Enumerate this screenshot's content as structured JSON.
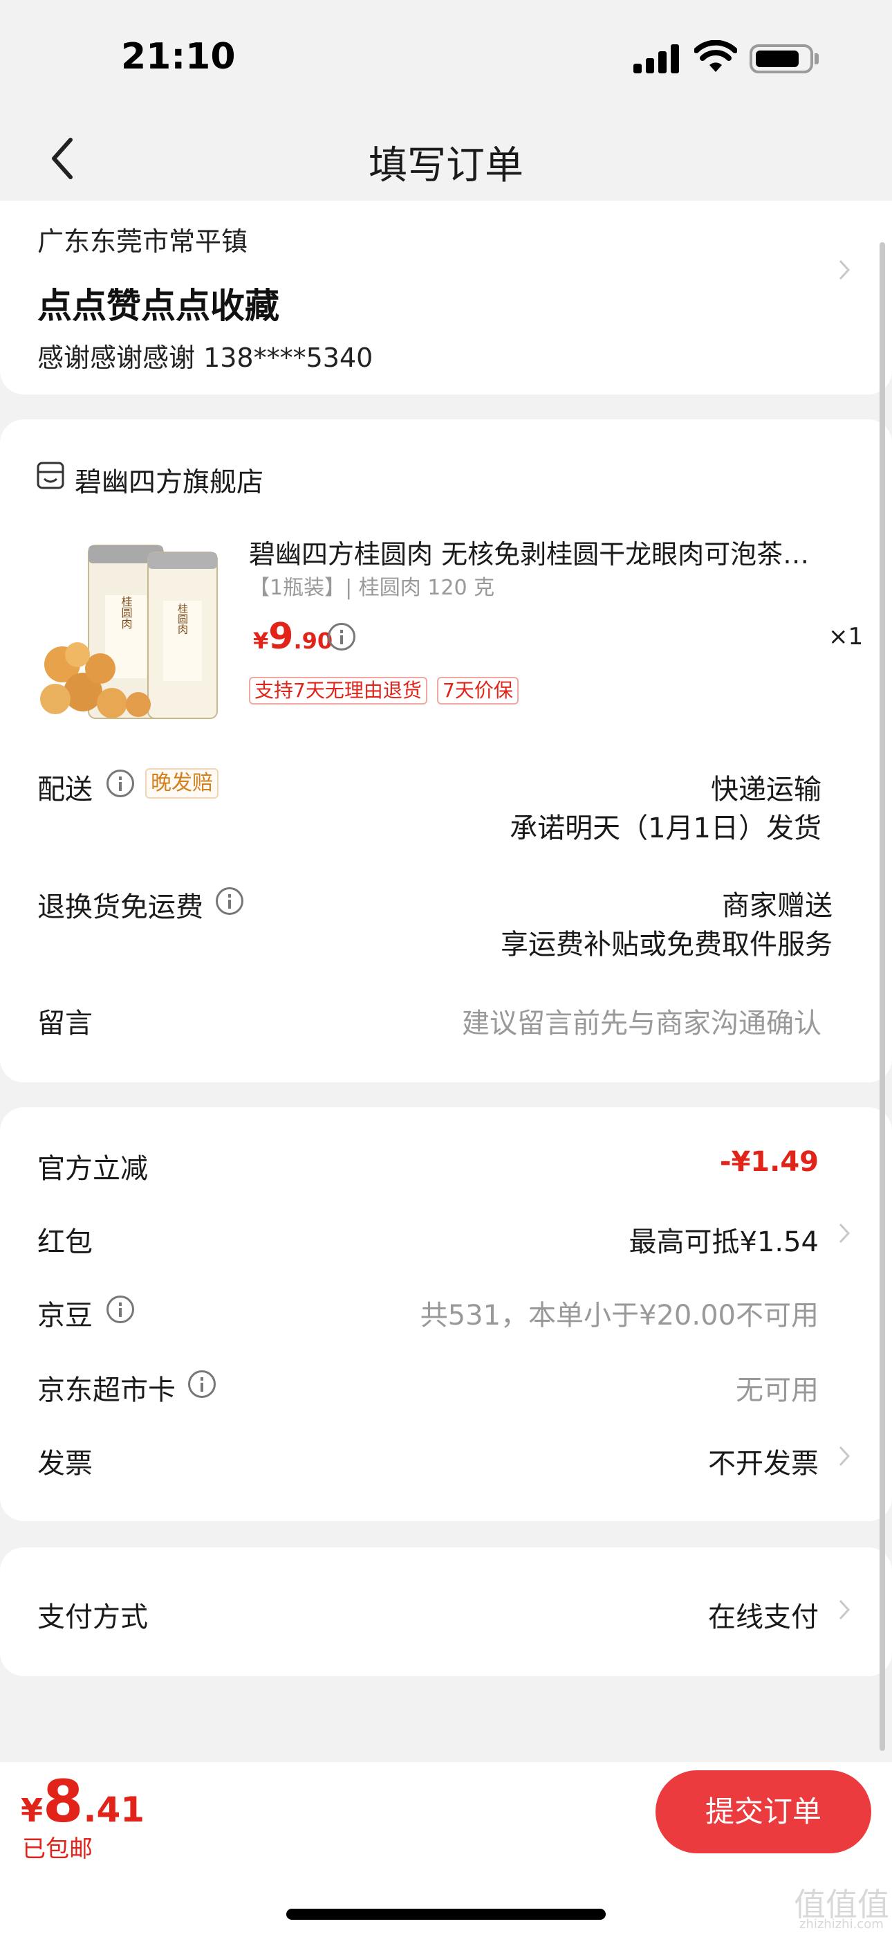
{
  "status_bar": {
    "time": "21:10"
  },
  "nav": {
    "title": "填写订单"
  },
  "address": {
    "region": "广东东莞市常平镇",
    "detail": "点点赞点点收藏",
    "contact": "感谢感谢感谢  138****5340"
  },
  "store": {
    "name": "碧幽四方旗舰店"
  },
  "product": {
    "title": "碧幽四方桂圆肉 无核免剥桂圆干龙眼肉可泡茶…",
    "spec": "【1瓶装】| 桂圆肉 120 克",
    "price_currency": "¥",
    "price_int": "9",
    "price_dec": ".90",
    "quantity": "×1",
    "tags": [
      "支持7天无理由退货",
      "7天价保"
    ],
    "image_label_1": "桂圆肉",
    "image_label_2": "桂圆肉"
  },
  "delivery": {
    "label": "配送",
    "tag": "晚发赔",
    "method": "快递运输",
    "promise": "承诺明天（1月1日）发货"
  },
  "return_shipping": {
    "label": "退换货免运费",
    "value": "商家赠送",
    "desc": "享运费补贴或免费取件服务"
  },
  "message": {
    "label": "留言",
    "placeholder": "建议留言前先与商家沟通确认"
  },
  "discounts": {
    "official": {
      "label": "官方立减",
      "value": "-¥1.49"
    },
    "red_packet": {
      "label": "红包",
      "value": "最高可抵¥1.54"
    },
    "jd_beans": {
      "label": "京豆",
      "value": "共531，本单小于¥20.00不可用"
    },
    "market_card": {
      "label": "京东超市卡",
      "value": "无可用"
    },
    "invoice": {
      "label": "发票",
      "value": "不开发票"
    }
  },
  "payment": {
    "label": "支付方式",
    "value": "在线支付"
  },
  "bottom": {
    "currency": "¥",
    "total_int": "8",
    "total_dec": ".41",
    "shipping": "已包邮",
    "submit": "提交订单"
  },
  "watermark": {
    "main": "值值值",
    "sub": "zhizhizhi.com"
  },
  "colors": {
    "accent": "#e2231a",
    "button": "#ec3b3f",
    "background": "#f2f2f2"
  }
}
